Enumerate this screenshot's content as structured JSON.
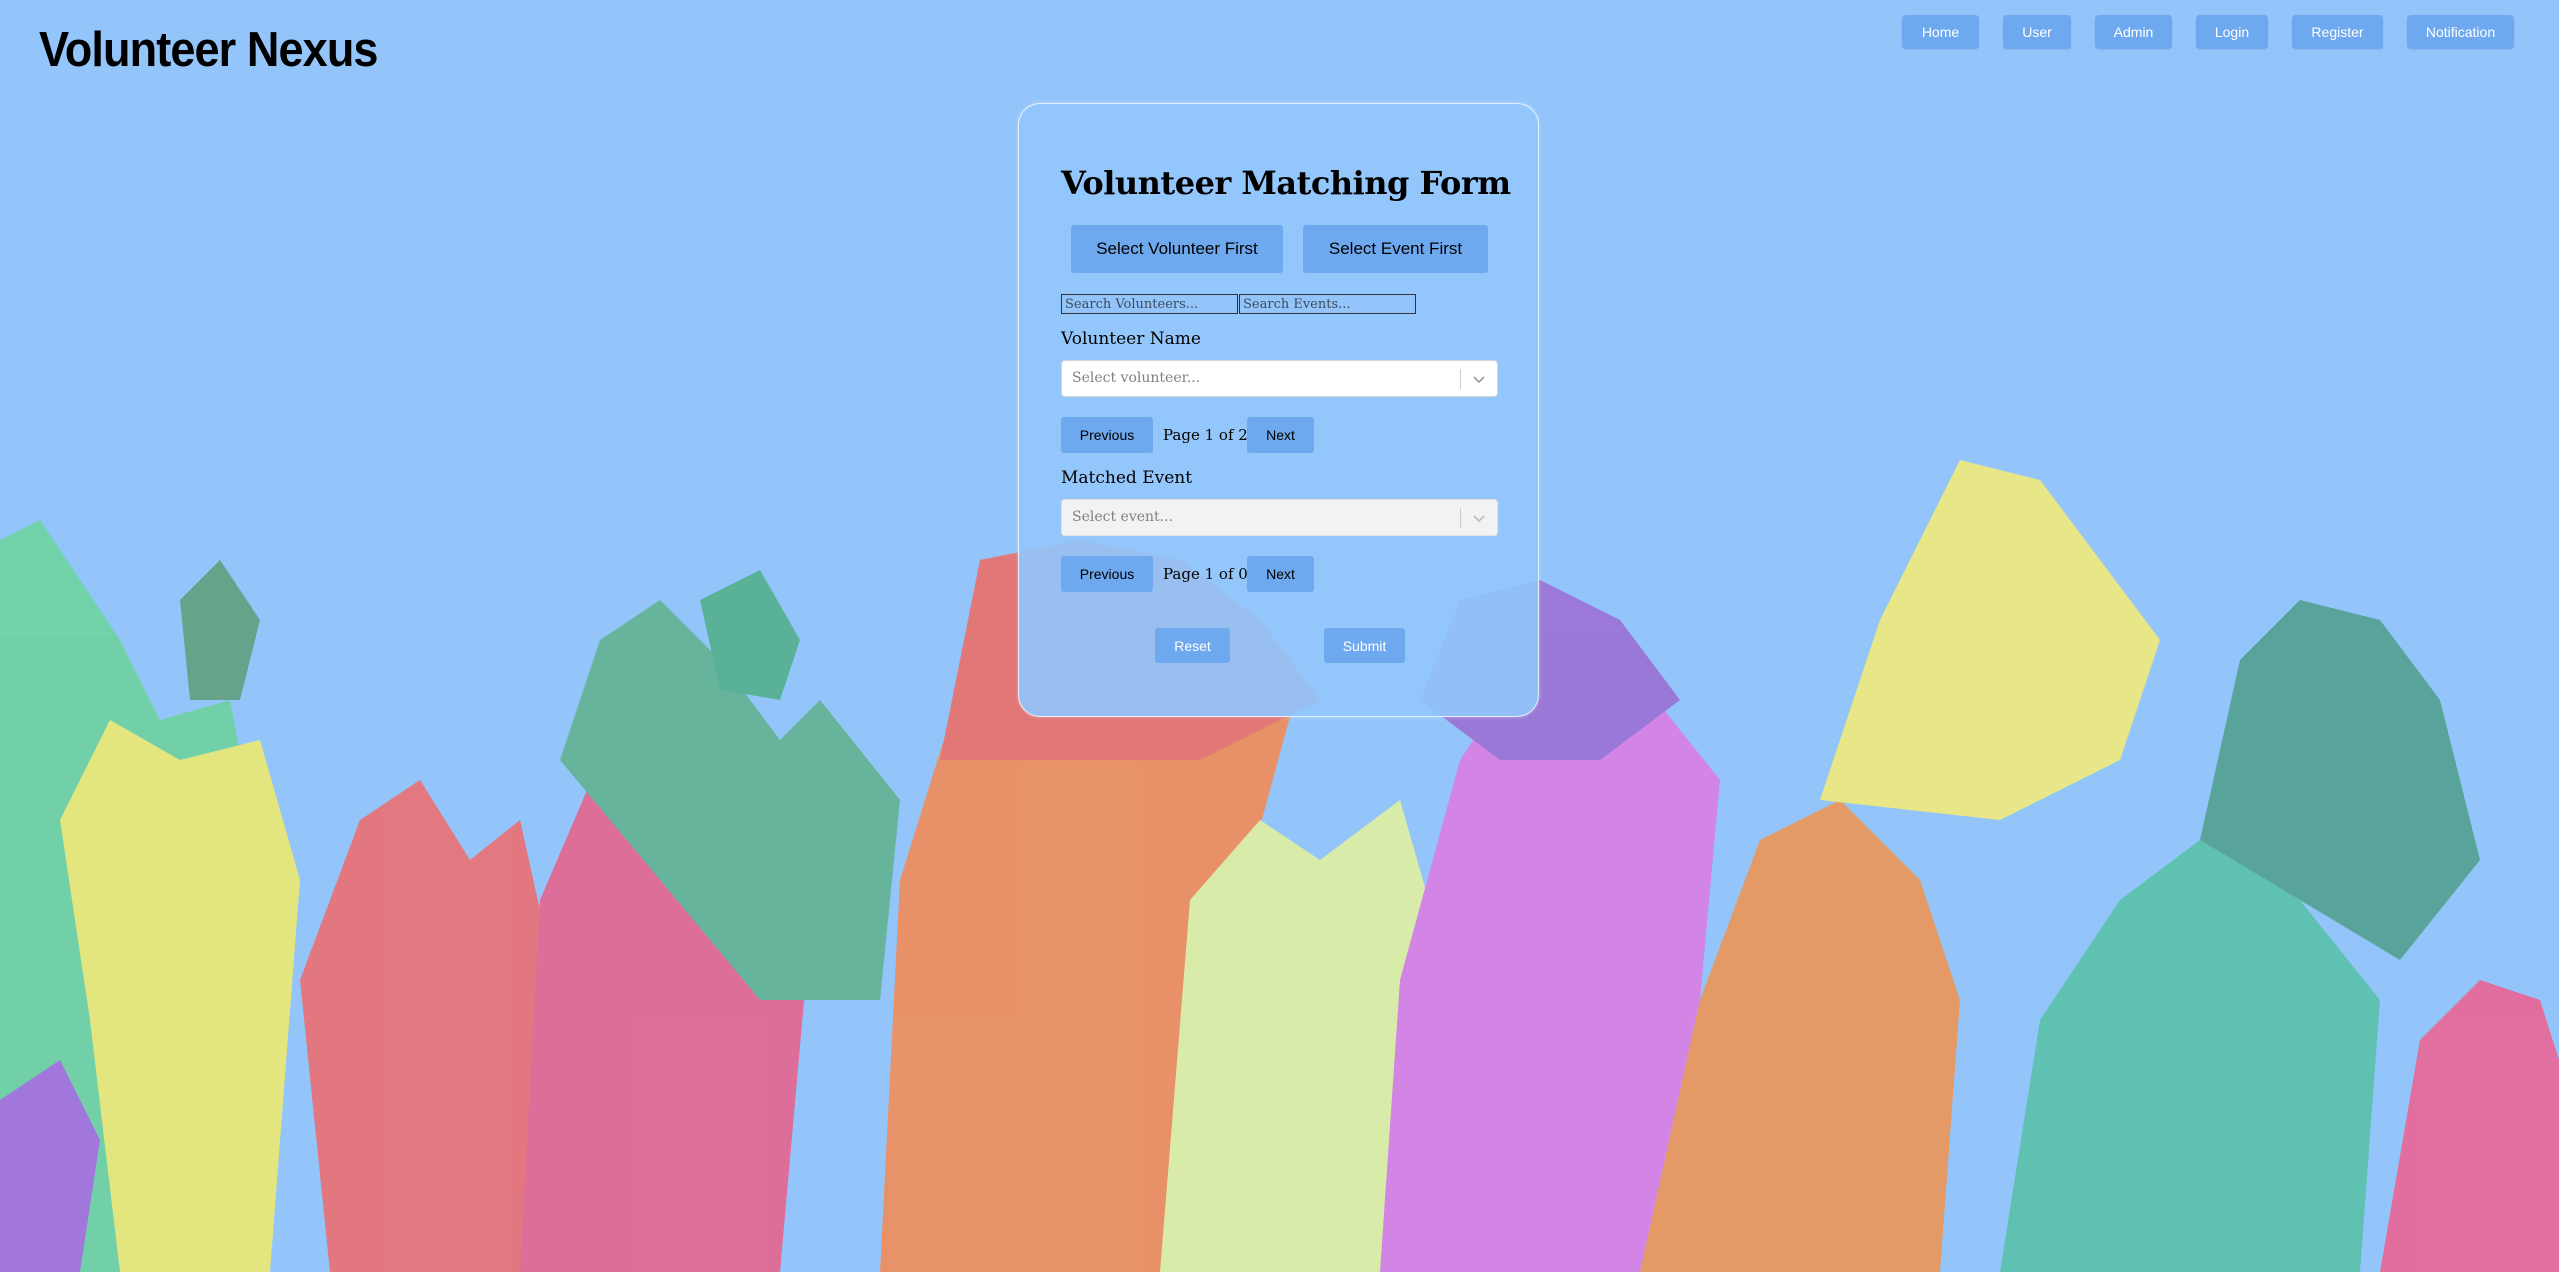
{
  "app": {
    "brand": "Volunteer Nexus"
  },
  "nav": {
    "items": [
      "Home",
      "User",
      "Admin",
      "Login",
      "Register",
      "Notification"
    ],
    "button_color": "#6ea8ee"
  },
  "form": {
    "title": "Volunteer Matching Form",
    "mode_buttons": {
      "volunteer_first": "Select Volunteer First",
      "event_first": "Select Event First"
    },
    "search": {
      "volunteers_placeholder": "Search Volunteers...",
      "events_placeholder": "Search Events..."
    },
    "volunteer": {
      "label": "Volunteer Name",
      "placeholder": "Select volunteer...",
      "pagination": {
        "previous": "Previous",
        "info": "Page 1 of 2",
        "next": "Next"
      }
    },
    "event": {
      "label": "Matched Event",
      "placeholder": "Select event...",
      "disabled": true,
      "pagination": {
        "previous": "Previous",
        "info": "Page 1 of 0",
        "next": "Next"
      }
    },
    "actions": {
      "reset": "Reset",
      "submit": "Submit"
    }
  },
  "colors": {
    "background": "#93c5fb",
    "accent": "#6ea8ee"
  },
  "icons": {
    "dropdown": "chevron-down-icon"
  }
}
